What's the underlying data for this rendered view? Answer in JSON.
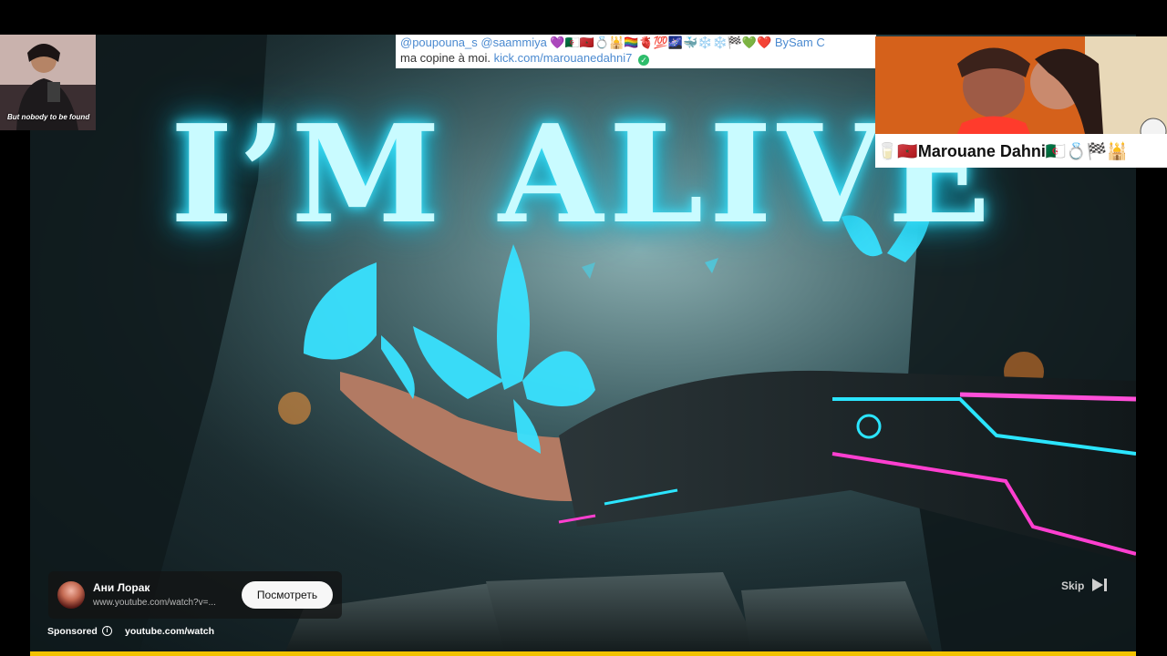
{
  "video": {
    "title_text": "I’M ALIVE"
  },
  "ad": {
    "advertiser_name": "Ани Лорак",
    "advertiser_url": "www.youtube.com/watch?v=...",
    "cta_label": "Посмотреть",
    "sponsored_label": "Sponsored",
    "sponsor_url": "youtube.com/watch",
    "skip_label": "Skip",
    "progress_color": "#f2c200"
  },
  "overlay_left": {
    "caption": "But nobody to be found"
  },
  "comment": {
    "line1": "@poupouna_s @saammiya 💜🇩🇿🇲🇦💍🕌🏳‍🌈🫀💯🌌🐳❄️❄️🏁💚❤️ BySam C",
    "line2_text": "ma copine à moi.",
    "line2_link": "kick.com/marouanedahni7",
    "verified_icon": "check-circle-icon"
  },
  "overlay_right": {
    "name": "🥛🇲🇦Marouane Dahni🇩🇿💍🏁🕌"
  }
}
